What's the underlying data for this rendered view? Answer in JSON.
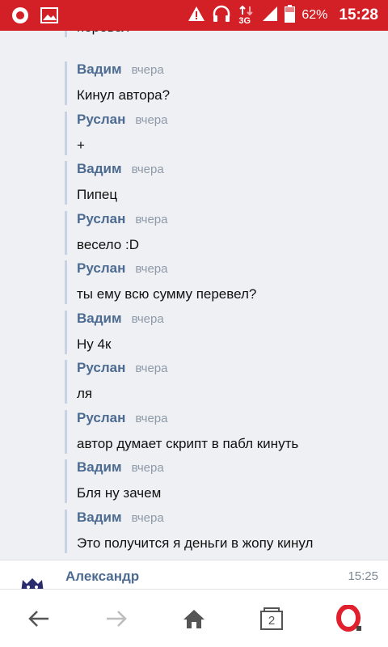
{
  "status_bar": {
    "battery_percent": "62%",
    "time": "15:28",
    "network": "3G"
  },
  "chat": {
    "partial_top_text": "перевел",
    "messages": [
      {
        "author": "Вадим",
        "time": "вчера",
        "text": "Кинул автора?"
      },
      {
        "author": "Руслан",
        "time": "вчера",
        "text": "+"
      },
      {
        "author": "Вадим",
        "time": "вчера",
        "text": "Пипец"
      },
      {
        "author": "Руслан",
        "time": "вчера",
        "text": "весело :D"
      },
      {
        "author": "Руслан",
        "time": "вчера",
        "text": "ты ему всю сумму перевел?"
      },
      {
        "author": "Вадим",
        "time": "вчера",
        "text": "Ну 4к"
      },
      {
        "author": "Руслан",
        "time": "вчера",
        "text": "ля"
      },
      {
        "author": "Руслан",
        "time": "вчера",
        "text": "автор думает скрипт в пабл кинуть"
      },
      {
        "author": "Вадим",
        "time": "вчера",
        "text": "Бля ну зачем"
      },
      {
        "author": "Вадим",
        "time": "вчера",
        "text": "Это получится я деньги в жопу кинул"
      }
    ]
  },
  "next_message": {
    "author": "Александр",
    "time": "15:25"
  },
  "navbar": {
    "tabs_count": "2"
  },
  "colors": {
    "status_bar": "#d31f26",
    "author": "#4d6b91",
    "opera": "#e2202d"
  }
}
